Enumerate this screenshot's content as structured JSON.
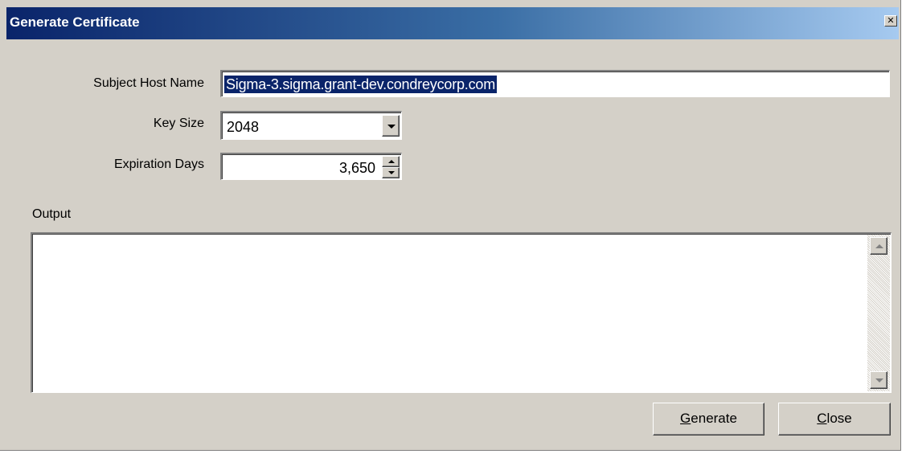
{
  "window": {
    "title": "Generate Certificate",
    "close_glyph": "✕"
  },
  "form": {
    "subject_host_name_label": "Subject Host Name",
    "subject_host_name_value": "Sigma-3.sigma.grant-dev.condreycorp.com",
    "key_size_label": "Key Size",
    "key_size_value": "2048",
    "expiration_days_label": "Expiration Days",
    "expiration_days_value": "3,650"
  },
  "output": {
    "label": "Output",
    "value": ""
  },
  "buttons": {
    "generate": {
      "mnemonic": "G",
      "rest": "enerate"
    },
    "close": {
      "mnemonic": "C",
      "rest": "lose"
    }
  },
  "icons": {
    "close": "close-icon",
    "dropdown": "chevron-down-icon",
    "spin_up": "arrow-up-icon",
    "spin_down": "arrow-down-icon",
    "scroll_up": "scroll-up-arrow-icon",
    "scroll_down": "scroll-down-arrow-icon"
  },
  "colors": {
    "titlebar_start": "#0a246a",
    "titlebar_end": "#a6caf0",
    "selection": "#0a246a",
    "dialog_bg": "#d4d0c8"
  }
}
